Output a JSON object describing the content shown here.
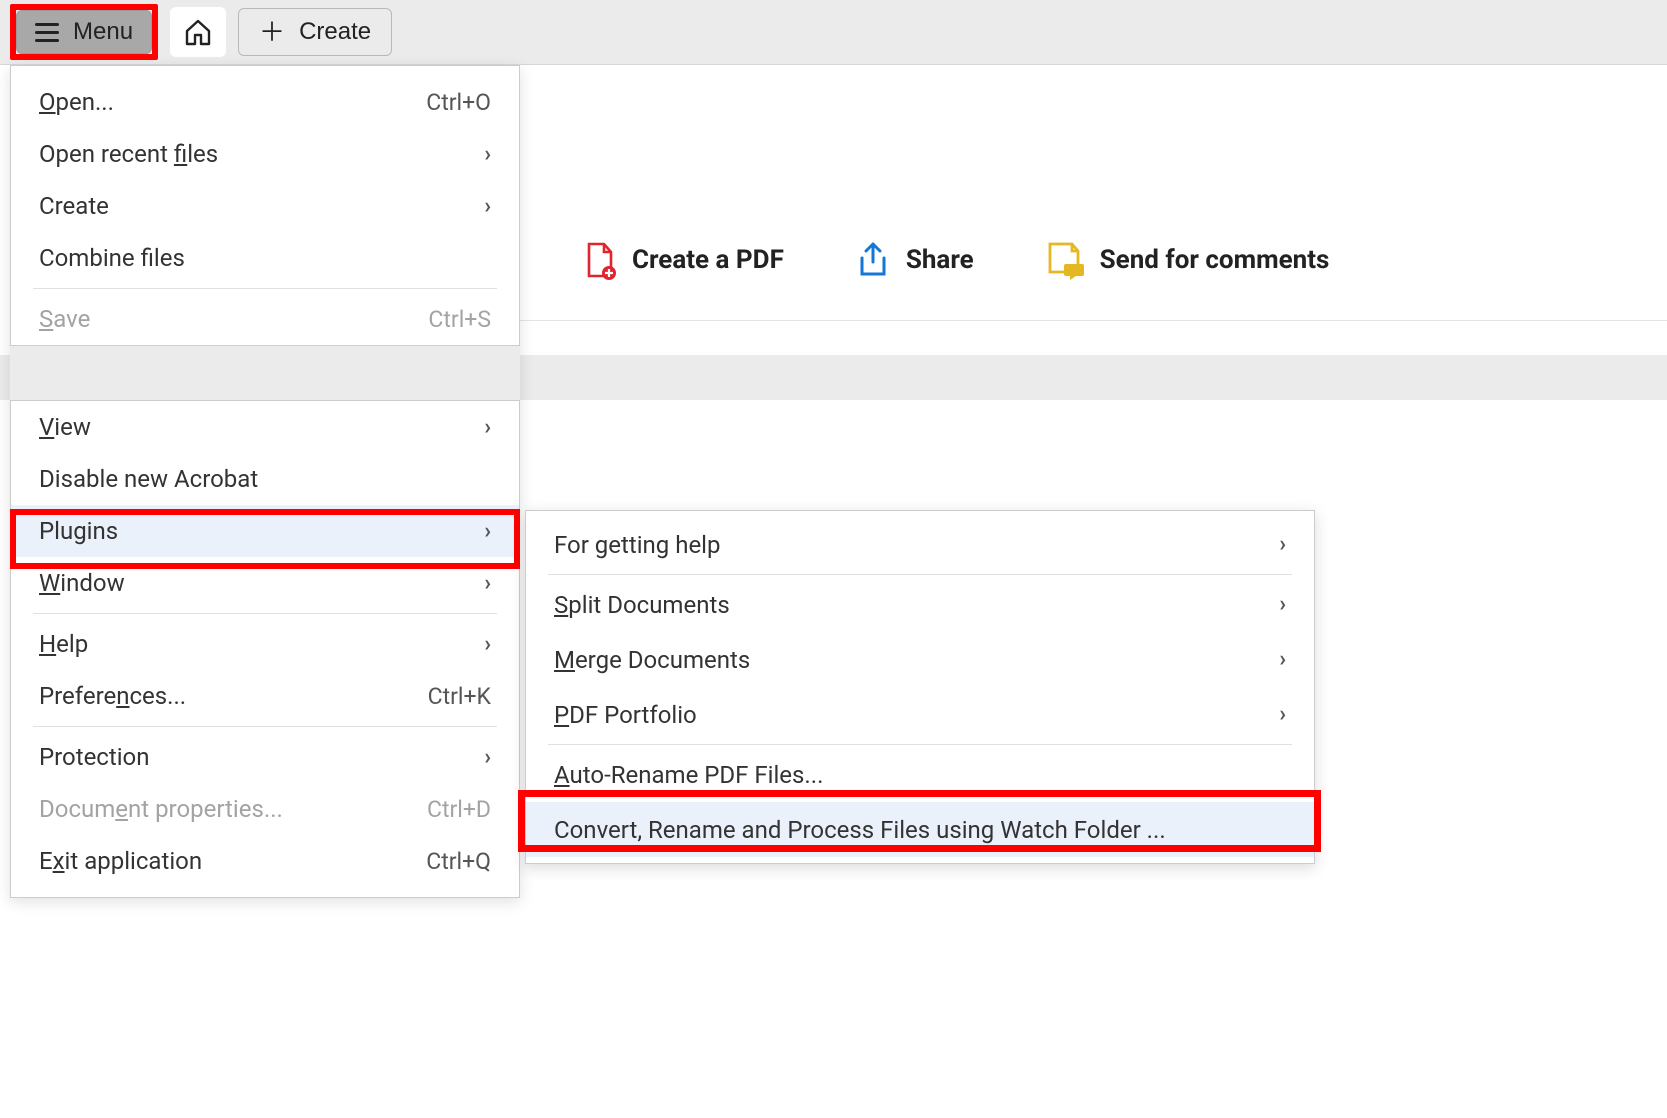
{
  "toolbar": {
    "menu_label": "Menu",
    "create_label": "Create"
  },
  "actions": {
    "create_pdf": "Create a PDF",
    "share": "Share",
    "send_comments": "Send for comments"
  },
  "menu": {
    "open": "Open...",
    "open_shortcut": "Ctrl+O",
    "open_recent": "Open recent files",
    "create": "Create",
    "combine": "Combine files",
    "save": "Save",
    "save_shortcut": "Ctrl+S",
    "view": "View",
    "disable_new": "Disable new Acrobat",
    "plugins": "Plugins",
    "window": "Window",
    "help": "Help",
    "preferences": "Preferences...",
    "preferences_shortcut": "Ctrl+K",
    "protection": "Protection",
    "doc_props": "Document properties...",
    "doc_props_shortcut": "Ctrl+D",
    "exit": "Exit application",
    "exit_shortcut": "Ctrl+Q"
  },
  "submenu": {
    "help": "For getting help",
    "split": "Split Documents",
    "merge": "Merge Documents",
    "portfolio": "PDF Portfolio",
    "autorename": "Auto-Rename PDF Files...",
    "watch": "Convert, Rename and Process Files using Watch Folder ..."
  }
}
